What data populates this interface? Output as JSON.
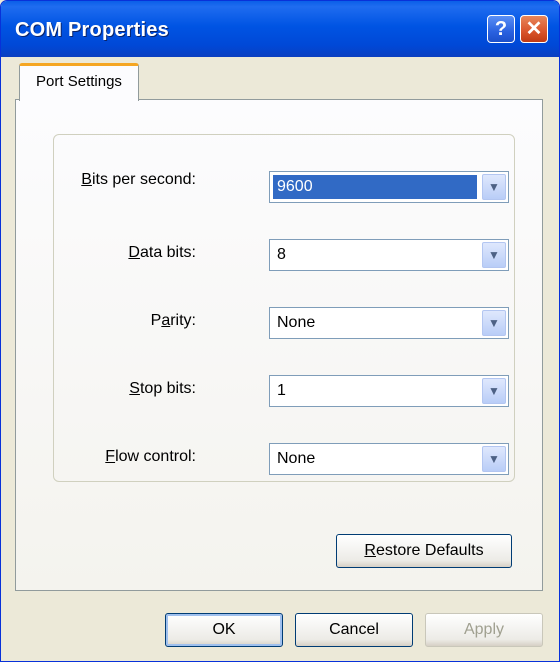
{
  "window": {
    "title": "COM Properties",
    "help_button": "?",
    "close_button": "✕"
  },
  "tabs": [
    {
      "label": "Port Settings",
      "active": true
    }
  ],
  "settings": {
    "bits_per_second": {
      "label_underlined": "B",
      "label_rest": "its per second:",
      "value": "9600"
    },
    "data_bits": {
      "label_underlined": "D",
      "label_rest": "ata bits:",
      "value": "8"
    },
    "parity": {
      "label_pre": "P",
      "label_underlined": "a",
      "label_rest": "rity:",
      "value": "None"
    },
    "stop_bits": {
      "label_underlined": "S",
      "label_rest": "top bits:",
      "value": "1"
    },
    "flow_control": {
      "label_underlined": "F",
      "label_rest": "low control:",
      "value": "None"
    }
  },
  "buttons": {
    "restore_underlined": "R",
    "restore_rest": "estore Defaults",
    "ok": "OK",
    "cancel": "Cancel",
    "apply": "Apply"
  },
  "icons": {
    "dropdown": "chevron-down-icon"
  },
  "colors": {
    "titlebar": "#0054e3",
    "selection": "#316ac5",
    "tab_accent": "#f5a623"
  }
}
